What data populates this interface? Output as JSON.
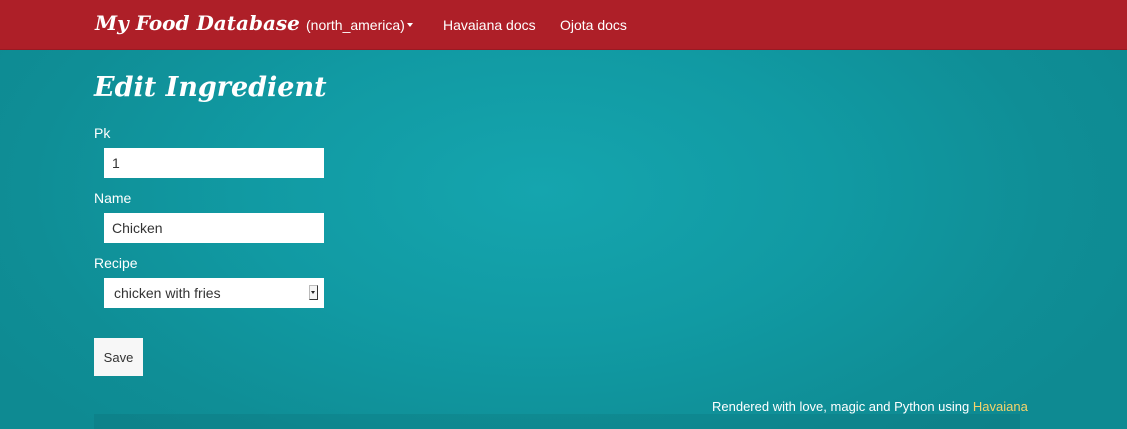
{
  "navbar": {
    "brand": "My Food Database",
    "region": "(north_america)",
    "links": [
      "Havaiana docs",
      "Ojota docs"
    ]
  },
  "page": {
    "title": "Edit Ingredient"
  },
  "form": {
    "pk": {
      "label": "Pk",
      "value": "1"
    },
    "name": {
      "label": "Name",
      "value": "Chicken"
    },
    "recipe": {
      "label": "Recipe",
      "value": "chicken with fries"
    },
    "save_label": "Save"
  },
  "footer": {
    "text": "Rendered with love, magic and Python using ",
    "link": "Havaiana"
  },
  "colors": {
    "navbar": "#ae1f28",
    "background": "#119aa3",
    "link_accent": "#f5d36b"
  }
}
